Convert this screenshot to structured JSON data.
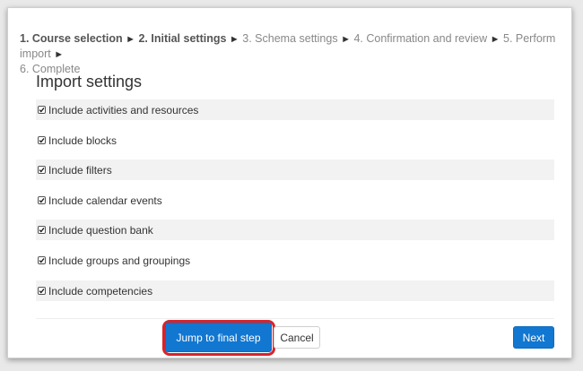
{
  "steps": [
    {
      "label": "1. Course selection",
      "state": "done"
    },
    {
      "label": "2. Initial settings",
      "state": "current"
    },
    {
      "label": "3. Schema settings",
      "state": "pending"
    },
    {
      "label": "4. Confirmation and review",
      "state": "pending"
    },
    {
      "label": "5. Perform import",
      "state": "pending"
    },
    {
      "label": "6. Complete",
      "state": "pending"
    }
  ],
  "step_separator": "►",
  "heading": "Import settings",
  "settings": [
    {
      "label": "Include activities and resources",
      "checked": true
    },
    {
      "label": "Include blocks",
      "checked": true
    },
    {
      "label": "Include filters",
      "checked": true
    },
    {
      "label": "Include calendar events",
      "checked": true
    },
    {
      "label": "Include question bank",
      "checked": true
    },
    {
      "label": "Include groups and groupings",
      "checked": true
    },
    {
      "label": "Include competencies",
      "checked": true
    }
  ],
  "buttons": {
    "jump": "Jump to final step",
    "cancel": "Cancel",
    "next": "Next"
  },
  "colors": {
    "primary": "#1177d1",
    "highlight": "#d9232b"
  }
}
